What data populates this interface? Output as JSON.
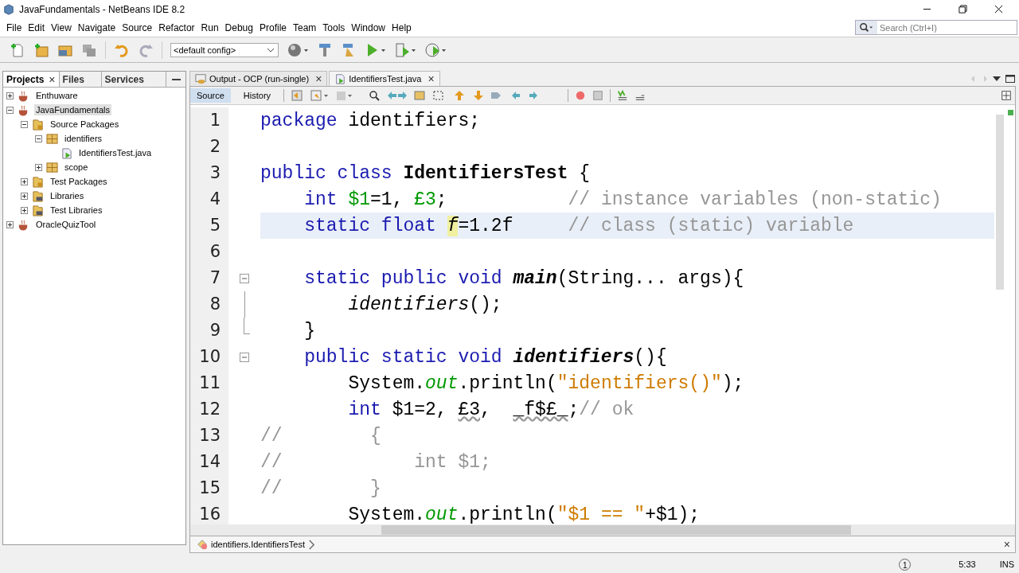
{
  "window": {
    "title": "JavaFundamentals - NetBeans IDE 8.2"
  },
  "menu": [
    "File",
    "Edit",
    "View",
    "Navigate",
    "Source",
    "Refactor",
    "Run",
    "Debug",
    "Profile",
    "Team",
    "Tools",
    "Window",
    "Help"
  ],
  "search": {
    "placeholder": "Search (Ctrl+I)"
  },
  "config": {
    "value": "<default config>"
  },
  "side_tabs": [
    {
      "label": "Projects",
      "selected": true,
      "close": "×"
    },
    {
      "label": "Files",
      "selected": false
    },
    {
      "label": "Services",
      "selected": false
    }
  ],
  "tree": [
    {
      "label": "Enthuware",
      "kind": "project",
      "expanded": false,
      "selected": false
    },
    {
      "label": "JavaFundamentals",
      "kind": "project",
      "expanded": true,
      "selected": true,
      "children": [
        {
          "label": "Source Packages",
          "kind": "source",
          "expanded": true,
          "selected": false,
          "children": [
            {
              "label": "identifiers",
              "kind": "package",
              "expanded": true,
              "selected": false,
              "children": [
                {
                  "label": "IdentifiersTest.java",
                  "kind": "java",
                  "selected": false
                }
              ]
            },
            {
              "label": "scope",
              "kind": "package",
              "expanded": false,
              "selected": false
            }
          ]
        },
        {
          "label": "Test Packages",
          "kind": "source",
          "expanded": false,
          "selected": false
        },
        {
          "label": "Libraries",
          "kind": "library",
          "expanded": false,
          "selected": false
        },
        {
          "label": "Test Libraries",
          "kind": "library",
          "expanded": false,
          "selected": false
        }
      ]
    },
    {
      "label": "OracleQuizTool",
      "kind": "project",
      "expanded": false,
      "selected": false
    }
  ],
  "editor_tabs": [
    {
      "label": "Output - OCP (run-single)",
      "kind": "output",
      "selected": false,
      "close": "×"
    },
    {
      "label": "IdentifiersTest.java",
      "kind": "java",
      "selected": true,
      "close": "×"
    }
  ],
  "view_toggle": [
    {
      "label": "Source",
      "selected": true
    },
    {
      "label": "History",
      "selected": false
    }
  ],
  "code": [
    {
      "number": "1",
      "current": false,
      "kind": "line",
      "tokens": [
        {
          "kind": "kw",
          "text": "package"
        },
        {
          "kind": "plain",
          "text": " identifiers;"
        }
      ]
    },
    {
      "number": "2",
      "current": false,
      "kind": "line"
    },
    {
      "number": "3",
      "current": false,
      "kind": "line",
      "tokens": [
        {
          "kind": "kw",
          "text": "public class "
        },
        {
          "kind": "bold",
          "text": "IdentifiersTest"
        },
        {
          "kind": "plain",
          "text": " {"
        }
      ]
    },
    {
      "number": "4",
      "current": false,
      "kind": "line",
      "tokens": [
        {
          "kind": "kw",
          "text": "    int "
        },
        {
          "kind": "field",
          "text": "$1"
        },
        {
          "kind": "plain",
          "text": "=1, "
        },
        {
          "kind": "field",
          "text": "£3"
        },
        {
          "kind": "plain",
          "text": ";           "
        },
        {
          "kind": "comment",
          "text": "// instance variables (non-static)"
        }
      ]
    },
    {
      "number": "5",
      "current": true,
      "kind": "line",
      "tokens": [
        {
          "kind": "kw",
          "text": "    static float "
        },
        {
          "kind": "mark",
          "text": "f"
        },
        {
          "kind": "plain",
          "text": "=1.2f     "
        },
        {
          "kind": "comment",
          "text": "// class (static) variable"
        }
      ]
    },
    {
      "number": "6",
      "current": false,
      "kind": "line"
    },
    {
      "number": "7",
      "current": false,
      "kind": "fold-start",
      "tokens": [
        {
          "kind": "kw",
          "text": "    static public void "
        },
        {
          "kind": "bolditalic",
          "text": "main"
        },
        {
          "kind": "plain",
          "text": "(String... args){"
        }
      ]
    },
    {
      "number": "8",
      "current": false,
      "kind": "fold-inner",
      "tokens": [
        {
          "kind": "italic",
          "text": "        identifiers"
        },
        {
          "kind": "plain",
          "text": "();"
        }
      ]
    },
    {
      "number": "9",
      "current": false,
      "kind": "fold-end",
      "tokens": [
        {
          "kind": "plain",
          "text": "    }"
        }
      ]
    },
    {
      "number": "10",
      "current": false,
      "kind": "fold-start",
      "tokens": [
        {
          "kind": "kw",
          "text": "    public static void "
        },
        {
          "kind": "bolditalic",
          "text": "identifiers"
        },
        {
          "kind": "plain",
          "text": "(){"
        }
      ]
    },
    {
      "number": "11",
      "current": false,
      "kind": "line",
      "tokens": [
        {
          "kind": "plain",
          "text": "        System."
        },
        {
          "kind": "static",
          "text": "out"
        },
        {
          "kind": "plain",
          "text": ".println("
        },
        {
          "kind": "string",
          "text": "\"identifiers()\""
        },
        {
          "kind": "plain",
          "text": ");"
        }
      ]
    },
    {
      "number": "12",
      "current": false,
      "kind": "line",
      "tokens": [
        {
          "kind": "kw",
          "text": "        int"
        },
        {
          "kind": "plain",
          "text": " $1=2, "
        },
        {
          "kind": "unused",
          "text": "£3"
        },
        {
          "kind": "plain",
          "text": ",  "
        },
        {
          "kind": "unused",
          "text": "_f$£_"
        },
        {
          "kind": "plain",
          "text": ";"
        },
        {
          "kind": "comment",
          "text": "// ok"
        }
      ]
    },
    {
      "number": "13",
      "current": false,
      "kind": "line",
      "tokens": [
        {
          "kind": "comment",
          "text": "//        {"
        }
      ]
    },
    {
      "number": "14",
      "current": false,
      "kind": "line",
      "tokens": [
        {
          "kind": "comment",
          "text": "//            int $1;"
        }
      ]
    },
    {
      "number": "15",
      "current": false,
      "kind": "line",
      "tokens": [
        {
          "kind": "comment",
          "text": "//        }"
        }
      ]
    },
    {
      "number": "16",
      "current": false,
      "kind": "line",
      "tokens": [
        {
          "kind": "plain",
          "text": "        System."
        },
        {
          "kind": "static",
          "text": "out"
        },
        {
          "kind": "plain",
          "text": ".println("
        },
        {
          "kind": "string",
          "text": "\"$1 == \""
        },
        {
          "kind": "plain",
          "text": "+$1);"
        }
      ]
    }
  ],
  "breadcrumb": {
    "label": "identifiers.IdentifiersTest",
    "close": "×"
  },
  "status_bar": {
    "notifications": "1",
    "position": "5:33",
    "mode": "INS"
  }
}
